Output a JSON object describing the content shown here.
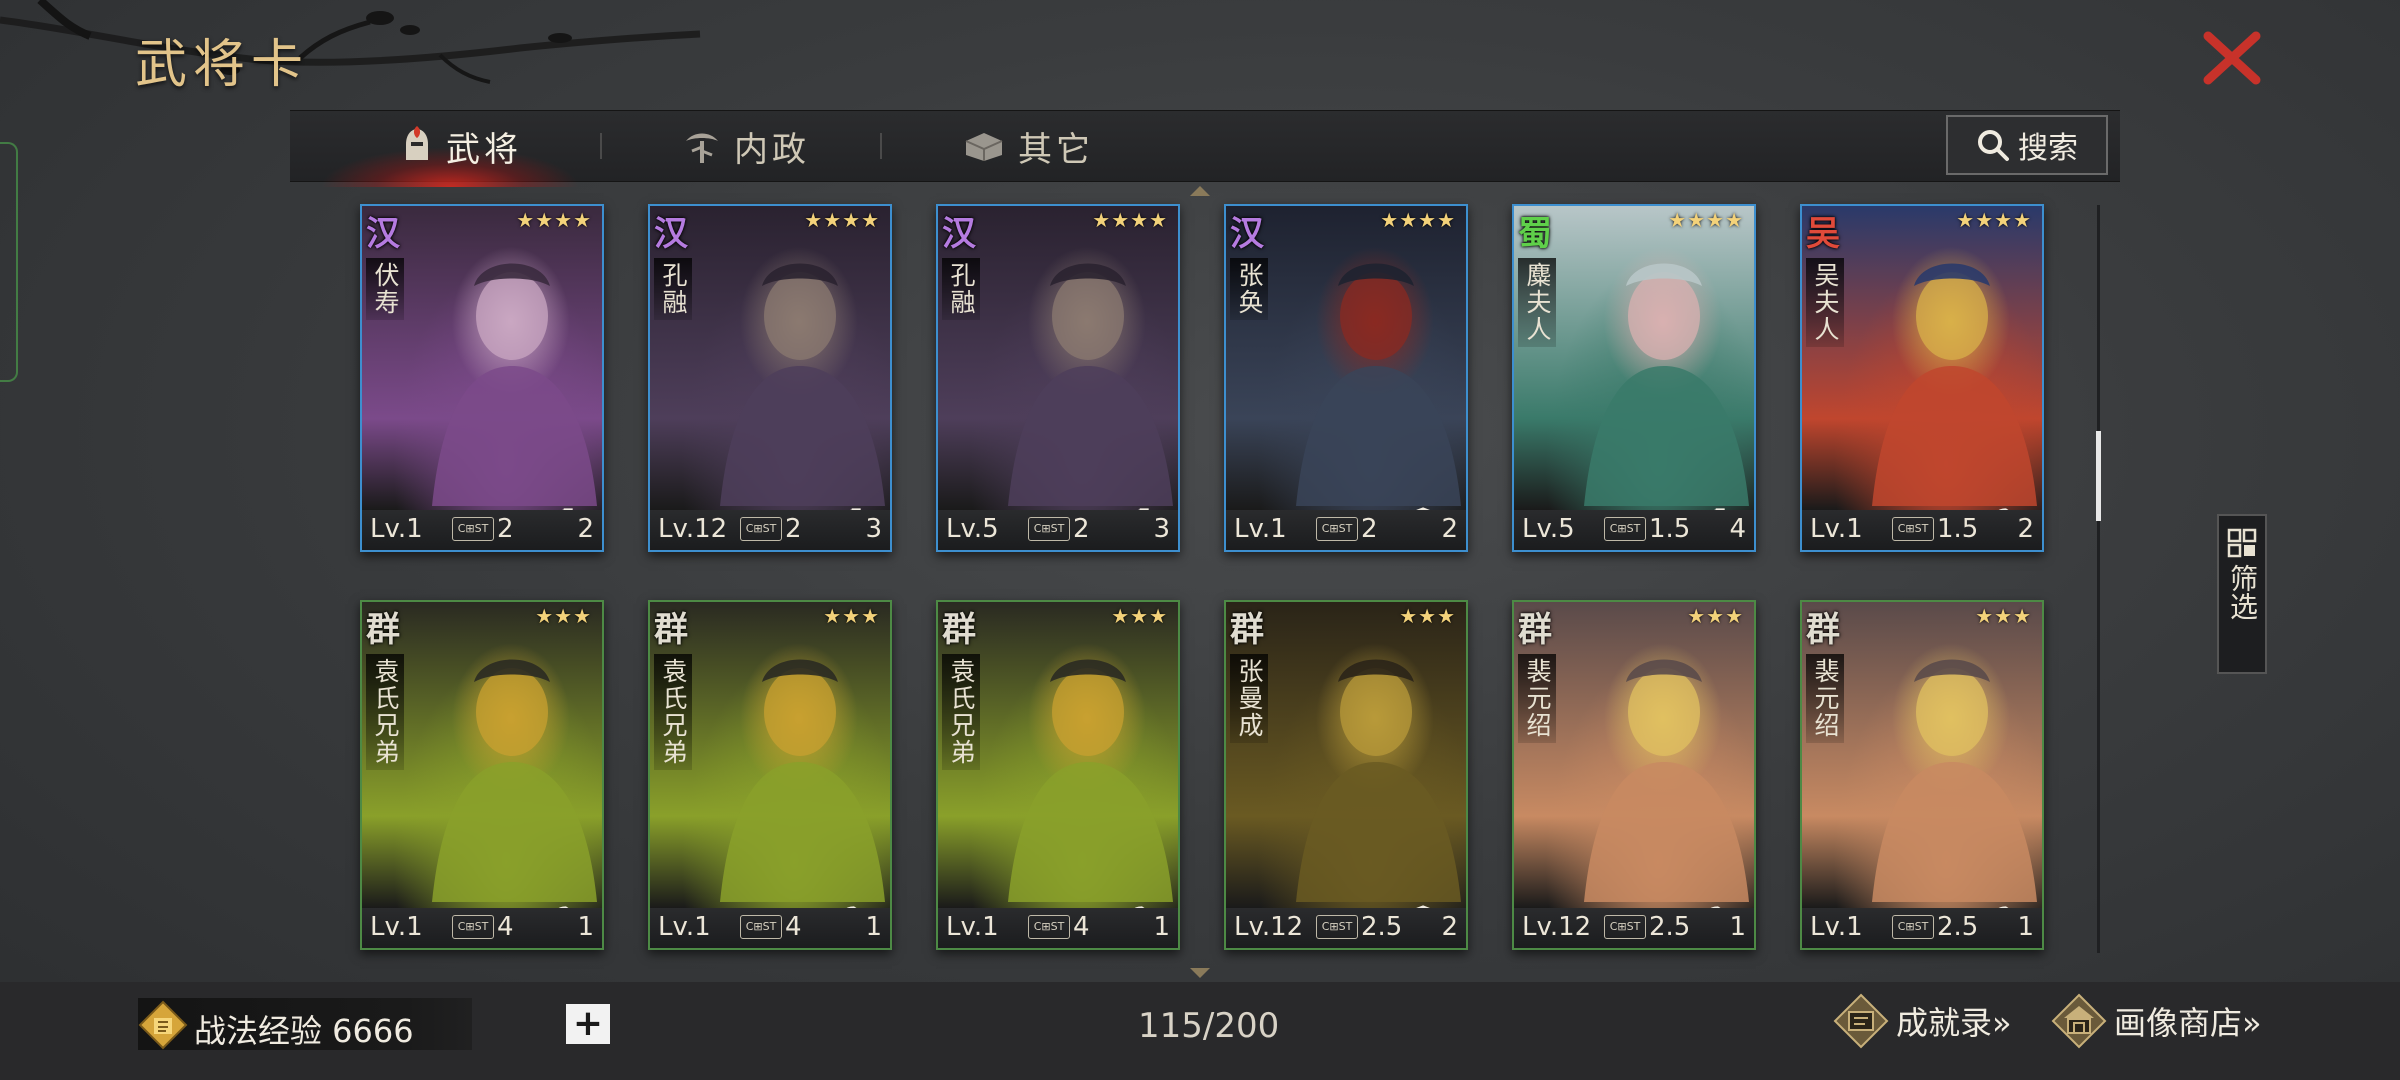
{
  "page": {
    "title": "武将卡"
  },
  "tabs": [
    {
      "label": "武将",
      "icon": "helmet-icon",
      "active": true
    },
    {
      "label": "内政",
      "icon": "tree-icon",
      "active": false
    },
    {
      "label": "其它",
      "icon": "box-icon",
      "active": false
    }
  ],
  "search": {
    "label": "搜索",
    "icon": "search-icon"
  },
  "cards": [
    {
      "faction": "汉",
      "faction_color": "#b57be0",
      "name": "伏寿",
      "stars": "★★★★",
      "level": "Lv.1",
      "cost": "2",
      "count": "2",
      "unit": "bow-icon",
      "palette": [
        "#7b4a8a",
        "#c9a7c2",
        "#3a2a3e"
      ]
    },
    {
      "faction": "汉",
      "faction_color": "#b57be0",
      "name": "孔融",
      "stars": "★★★★",
      "level": "Lv.12",
      "cost": "2",
      "count": "3",
      "unit": "bow-icon",
      "palette": [
        "#4e3e5a",
        "#8b7a70",
        "#2a2230"
      ]
    },
    {
      "faction": "汉",
      "faction_color": "#b57be0",
      "name": "孔融",
      "stars": "★★★★",
      "level": "Lv.5",
      "cost": "2",
      "count": "3",
      "unit": "bow-icon",
      "palette": [
        "#4e3e5a",
        "#8b7a70",
        "#2a2230"
      ]
    },
    {
      "faction": "汉",
      "faction_color": "#b57be0",
      "name": "张奂",
      "stars": "★★★★",
      "level": "Lv.1",
      "cost": "2",
      "count": "2",
      "unit": "shield-icon",
      "palette": [
        "#3a4458",
        "#8a2a22",
        "#1e2230"
      ]
    },
    {
      "faction": "蜀",
      "faction_color": "#5fd04a",
      "name": "麋夫人",
      "stars": "★★★★",
      "level": "Lv.5",
      "cost": "1.5",
      "count": "4",
      "unit": "bow-icon",
      "palette": [
        "#3a7a6a",
        "#d8b0b0",
        "#b8c6c8"
      ]
    },
    {
      "faction": "吴",
      "faction_color": "#e04a3a",
      "name": "吴夫人",
      "stars": "★★★★",
      "level": "Lv.1",
      "cost": "1.5",
      "count": "2",
      "unit": "horse-icon",
      "palette": [
        "#c0462e",
        "#d8b04a",
        "#2a3a6a"
      ]
    },
    {
      "faction": "群",
      "faction_color": "#e0dcd0",
      "name": "袁氏兄弟",
      "stars": "★★★",
      "level": "Lv.1",
      "cost": "4",
      "count": "1",
      "unit": "horse-icon",
      "palette": [
        "#8aa02a",
        "#c8a030",
        "#2a2a22"
      ]
    },
    {
      "faction": "群",
      "faction_color": "#e0dcd0",
      "name": "袁氏兄弟",
      "stars": "★★★",
      "level": "Lv.1",
      "cost": "4",
      "count": "1",
      "unit": "horse-icon",
      "palette": [
        "#8aa02a",
        "#c8a030",
        "#2a2a22"
      ]
    },
    {
      "faction": "群",
      "faction_color": "#e0dcd0",
      "name": "袁氏兄弟",
      "stars": "★★★",
      "level": "Lv.1",
      "cost": "4",
      "count": "1",
      "unit": "horse-icon",
      "palette": [
        "#8aa02a",
        "#c8a030",
        "#2a2a22"
      ]
    },
    {
      "faction": "群",
      "faction_color": "#e0dcd0",
      "name": "张曼成",
      "stars": "★★★",
      "level": "Lv.12",
      "cost": "2.5",
      "count": "2",
      "unit": "shield-icon",
      "palette": [
        "#6a5a22",
        "#b89a3a",
        "#2a2418"
      ]
    },
    {
      "faction": "群",
      "faction_color": "#e0dcd0",
      "name": "裴元绍",
      "stars": "★★★",
      "level": "Lv.12",
      "cost": "2.5",
      "count": "1",
      "unit": "horse-icon",
      "palette": [
        "#c88a62",
        "#e0c060",
        "#5a4a4a"
      ]
    },
    {
      "faction": "群",
      "faction_color": "#e0dcd0",
      "name": "裴元绍",
      "stars": "★★★",
      "level": "Lv.1",
      "cost": "2.5",
      "count": "1",
      "unit": "horse-icon",
      "palette": [
        "#c88a62",
        "#e0c060",
        "#5a4a4a"
      ]
    }
  ],
  "cost_icon_text": "C⊞ST",
  "filter": {
    "label": "筛选",
    "icon": "grid-icon"
  },
  "footer": {
    "exp_label": "战法经验 6666",
    "plus": "+",
    "page_count": "115/200",
    "achievements": "成就录»",
    "portrait_shop": "画像商店»"
  },
  "colors": {
    "gold": "#e2c48a",
    "close_red": "#c8322a",
    "blue_border": "#3d8fcf",
    "green_border": "#4d8a45"
  }
}
